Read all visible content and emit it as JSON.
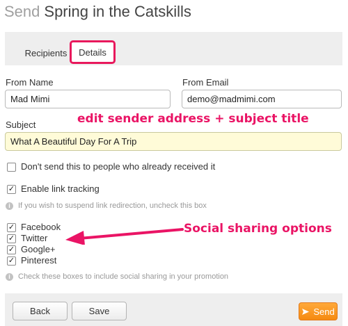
{
  "header": {
    "verb": "Send",
    "campaign_name": "Spring in the Catskills"
  },
  "tabs": [
    {
      "label": "Recipients"
    },
    {
      "label": "Details"
    }
  ],
  "form": {
    "from_name": {
      "label": "From Name",
      "value": "Mad Mimi"
    },
    "from_email": {
      "label": "From Email",
      "value": "demo@madmimi.com"
    },
    "subject": {
      "label": "Subject",
      "value": "What A Beautiful Day For A Trip"
    }
  },
  "options": {
    "dont_resend": {
      "label": "Don't send this to people who already received it",
      "checked": false
    },
    "link_tracking": {
      "label": "Enable link tracking",
      "checked": true
    },
    "link_tracking_hint": "If you wish to suspend link redirection, uncheck this box"
  },
  "social": {
    "items": [
      {
        "label": "Facebook",
        "checked": true
      },
      {
        "label": "Twitter",
        "checked": true
      },
      {
        "label": "Google+",
        "checked": true
      },
      {
        "label": "Pinterest",
        "checked": true
      }
    ],
    "hint": "Check these boxes to include social sharing in your promotion"
  },
  "annotations": {
    "sender": "edit sender address + subject title",
    "social": "Social sharing options",
    "color": "#ea1465"
  },
  "footer": {
    "back_label": "Back",
    "save_label": "Save",
    "send_label": "Send"
  },
  "colors": {
    "accent": "#e8185c",
    "send_button": "#f58a10",
    "subject_bg": "#fffbd8"
  }
}
